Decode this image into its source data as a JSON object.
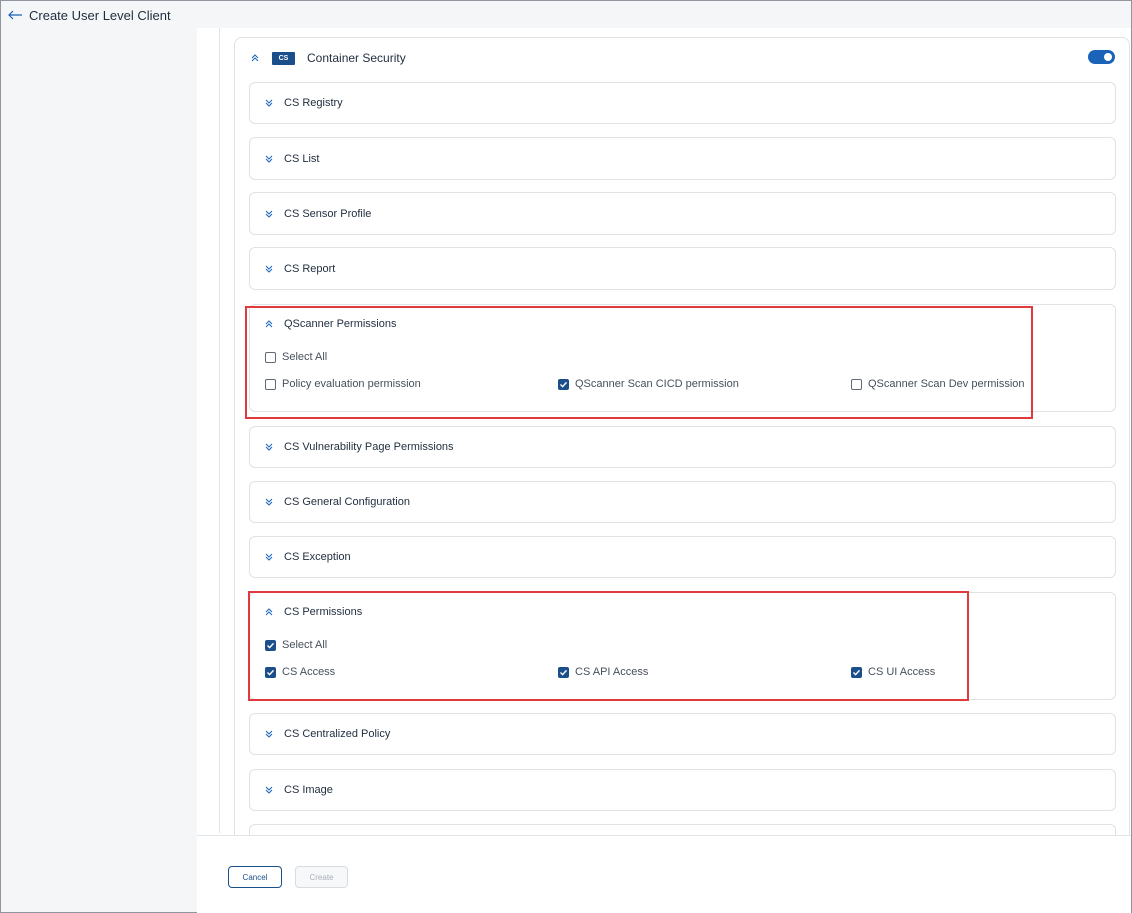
{
  "window": {
    "title": "Create User Level Client"
  },
  "module": {
    "badge": "CS",
    "label": "Container Security",
    "enabled": true
  },
  "sections": {
    "registry": "CS Registry",
    "list": "CS List",
    "sensor_profile": "CS Sensor Profile",
    "report": "CS Report",
    "qscanner": {
      "label": "QScanner Permissions",
      "select_all": "Select All",
      "select_all_checked": false,
      "options": [
        {
          "label": "Policy evaluation permission",
          "checked": false
        },
        {
          "label": "QScanner Scan CICD permission",
          "checked": true
        },
        {
          "label": "QScanner Scan Dev permission",
          "checked": false
        }
      ]
    },
    "vulnerability": "CS Vulnerability Page Permissions",
    "general_config": "CS General Configuration",
    "exception": "CS Exception",
    "permissions": {
      "label": "CS Permissions",
      "select_all": "Select All",
      "select_all_checked": true,
      "options": [
        {
          "label": "CS Access",
          "checked": true
        },
        {
          "label": "CS API Access",
          "checked": true
        },
        {
          "label": "CS UI Access",
          "checked": true
        }
      ]
    },
    "centralized_policy": "CS Centralized Policy",
    "image": "CS Image"
  },
  "footer": {
    "cancel_label": "Cancel",
    "create_label": "Create"
  },
  "colors": {
    "accent": "#1a4f8b",
    "toggle": "#1a63b8",
    "highlight": "#e0393e"
  }
}
